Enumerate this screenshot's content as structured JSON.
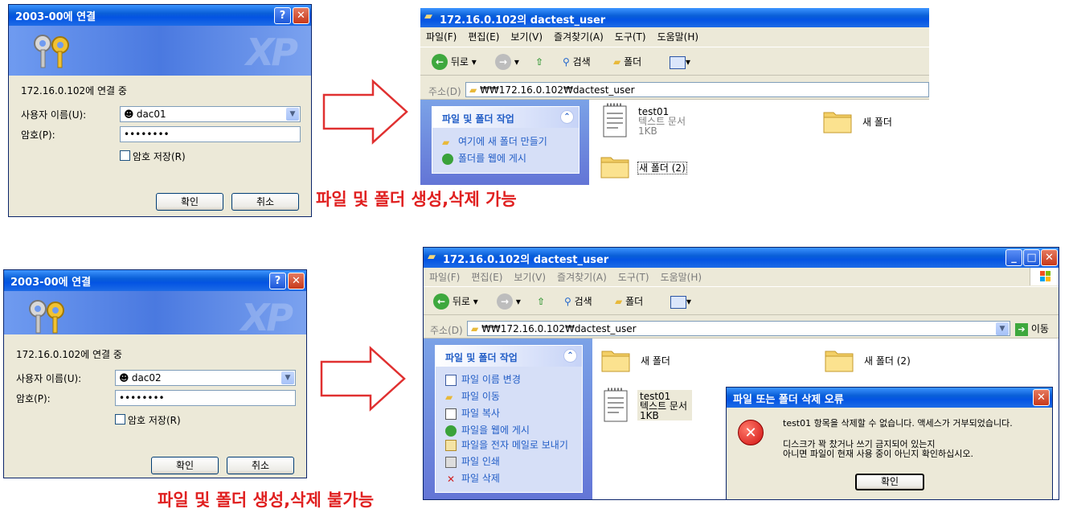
{
  "login1": {
    "title": "2003-00에 연결",
    "help": "?",
    "close": "✕",
    "connecting": "172.16.0.102에 연결 중",
    "user_label": "사용자 이름(U):",
    "user_value": "dac01",
    "pw_label": "암호(P):",
    "pw_value": "••••••••",
    "save_pw": "암호 저장(R)",
    "ok": "확인",
    "cancel": "취소"
  },
  "login2": {
    "title": "2003-00에 연결",
    "help": "?",
    "close": "✕",
    "connecting": "172.16.0.102에 연결 중",
    "user_label": "사용자 이름(U):",
    "user_value": "dac02",
    "pw_label": "암호(P):",
    "pw_value": "••••••••",
    "save_pw": "암호 저장(R)",
    "ok": "확인",
    "cancel": "취소"
  },
  "explorer1": {
    "title": "172.16.0.102의 dactest_user",
    "menu": [
      "파일(F)",
      "편집(E)",
      "보기(V)",
      "즐겨찾기(A)",
      "도구(T)",
      "도움말(H)"
    ],
    "back": "뒤로",
    "search": "검색",
    "folders": "폴더",
    "address_label": "주소(D)",
    "address": "₩₩172.16.0.102₩dactest_user",
    "task_title": "파일 및 폴더 작업",
    "tasks": [
      "여기에 새 폴더 만들기",
      "폴더를 웹에 게시"
    ],
    "files": {
      "test01_name": "test01",
      "test01_type": "텍스트 문서",
      "test01_size": "1KB",
      "newfolder": "새 폴더",
      "newfolder2": "새 폴더 (2)"
    }
  },
  "explorer2": {
    "title": "172.16.0.102의 dactest_user",
    "menu": [
      "파일(F)",
      "편집(E)",
      "보기(V)",
      "즐겨찾기(A)",
      "도구(T)",
      "도움말(H)"
    ],
    "back": "뒤로",
    "search": "검색",
    "folders": "폴더",
    "address_label": "주소(D)",
    "address": "₩₩172.16.0.102₩dactest_user",
    "go": "이동",
    "task_title": "파일 및 폴더 작업",
    "tasks": [
      "파일 이름 변경",
      "파일 이동",
      "파일 복사",
      "파일을 웹에 게시",
      "파일을 전자 메일로 보내기",
      "파일 인쇄",
      "파일 삭제"
    ],
    "files": {
      "newfolder": "새 폴더",
      "newfolder2": "새 폴더 (2)",
      "test01_name": "test01",
      "test01_type": "텍스트 문서",
      "test01_size": "1KB"
    }
  },
  "error_dialog": {
    "title": "파일 또는 폴더 삭제 오류",
    "line1": "test01 항목을 삭제할 수 없습니다. 액세스가 거부되었습니다.",
    "line2": "디스크가 꽉 찼거나 쓰기 금지되어 있는지",
    "line3": "아니면 파일이 현재 사용 중이 아닌지 확인하십시오.",
    "ok": "확인"
  },
  "captions": {
    "top": "파일 및 폴더 생성,삭제 가능",
    "bottom": "파일 및 폴더 생성,삭제 불가능"
  },
  "colors": {
    "caption_red": "#e02020",
    "xp_title_blue": "#0454e3",
    "arrow_red": "#e03030"
  }
}
